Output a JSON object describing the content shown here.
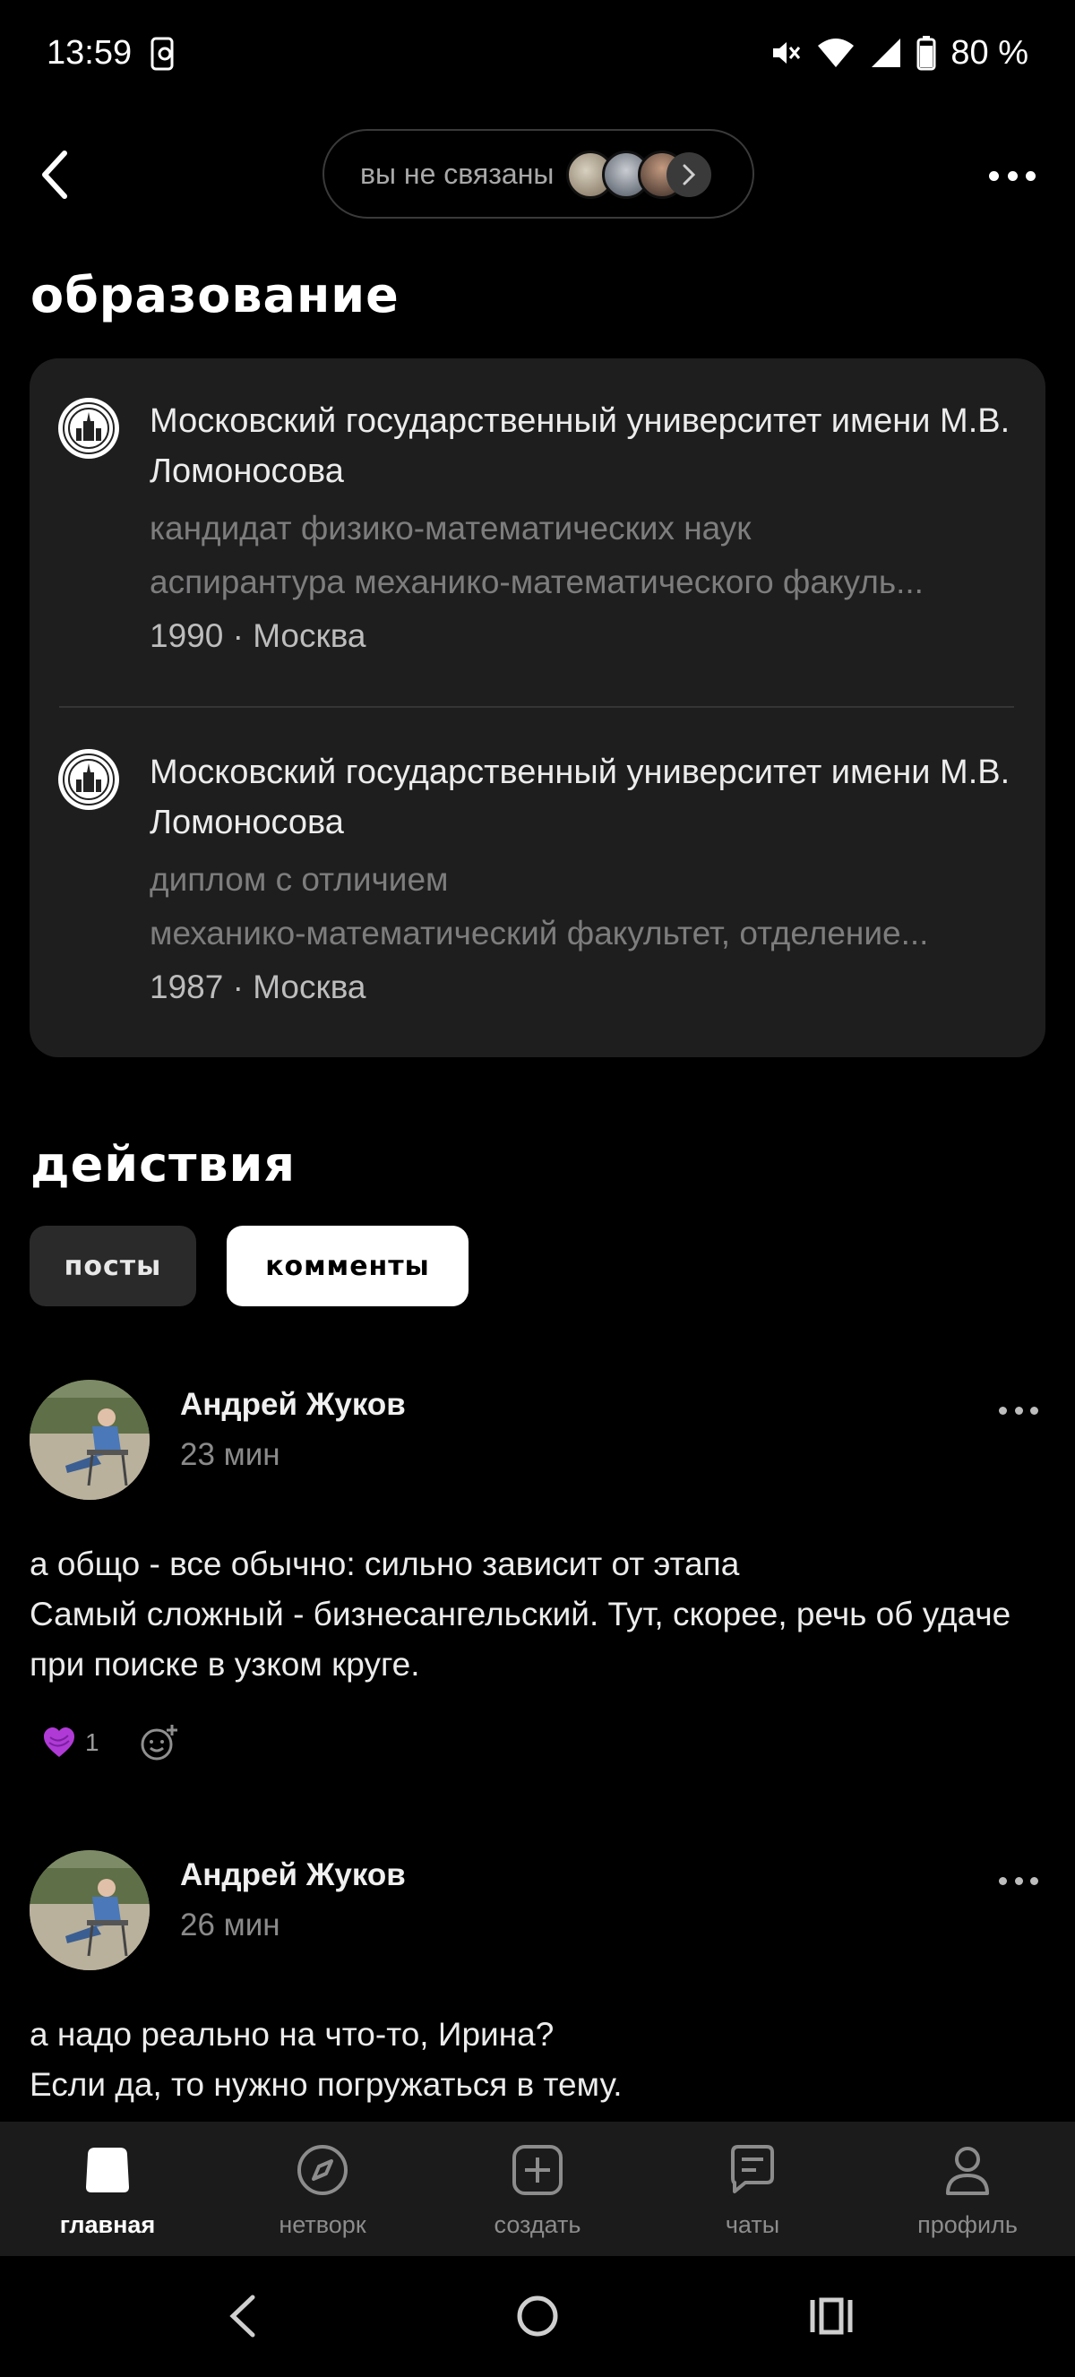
{
  "status_bar": {
    "time": "13:59",
    "battery": "80 %"
  },
  "header": {
    "connection_text": "вы не связаны"
  },
  "education": {
    "title": "образование",
    "items": [
      {
        "university": "Московский государственный университет имени М.В. Ломоносова",
        "degree": "кандидат физико-математических наук",
        "field": "аспирантура механико-математического факуль...",
        "meta": "1990 · Москва"
      },
      {
        "university": "Московский государственный университет имени М.В. Ломоносова",
        "degree": "диплом с отличием",
        "field": "механико-математический факультет, отделение...",
        "meta": "1987 · Москва"
      }
    ]
  },
  "actions": {
    "title": "действия",
    "tabs": [
      {
        "label": "посты",
        "active": false
      },
      {
        "label": "комменты",
        "active": true
      }
    ]
  },
  "posts": [
    {
      "author": "Андрей Жуков",
      "time": "23 мин",
      "text": "а общо - все обычно: сильно зависит от этапа\nСамый сложный - бизнесангельский. Тут, скорее, речь об удаче при поиске в узком круге.",
      "likes": "1"
    },
    {
      "author": "Андрей Жуков",
      "time": "26 мин",
      "text": "а надо реально на что-то, Ирина?\nЕсли да, то нужно погружаться в тему."
    }
  ],
  "bottom_nav": {
    "items": [
      {
        "label": "главная",
        "icon": "home-icon",
        "active": true
      },
      {
        "label": "нетворк",
        "icon": "compass-icon",
        "active": false
      },
      {
        "label": "создать",
        "icon": "plus-square-icon",
        "active": false
      },
      {
        "label": "чаты",
        "icon": "chat-icon",
        "active": false
      },
      {
        "label": "профиль",
        "icon": "user-icon",
        "active": false
      }
    ]
  },
  "colors": {
    "background": "#000000",
    "card": "#1e1e1f",
    "like": "#b03ad6",
    "nav_bg": "#1b1b1c"
  }
}
